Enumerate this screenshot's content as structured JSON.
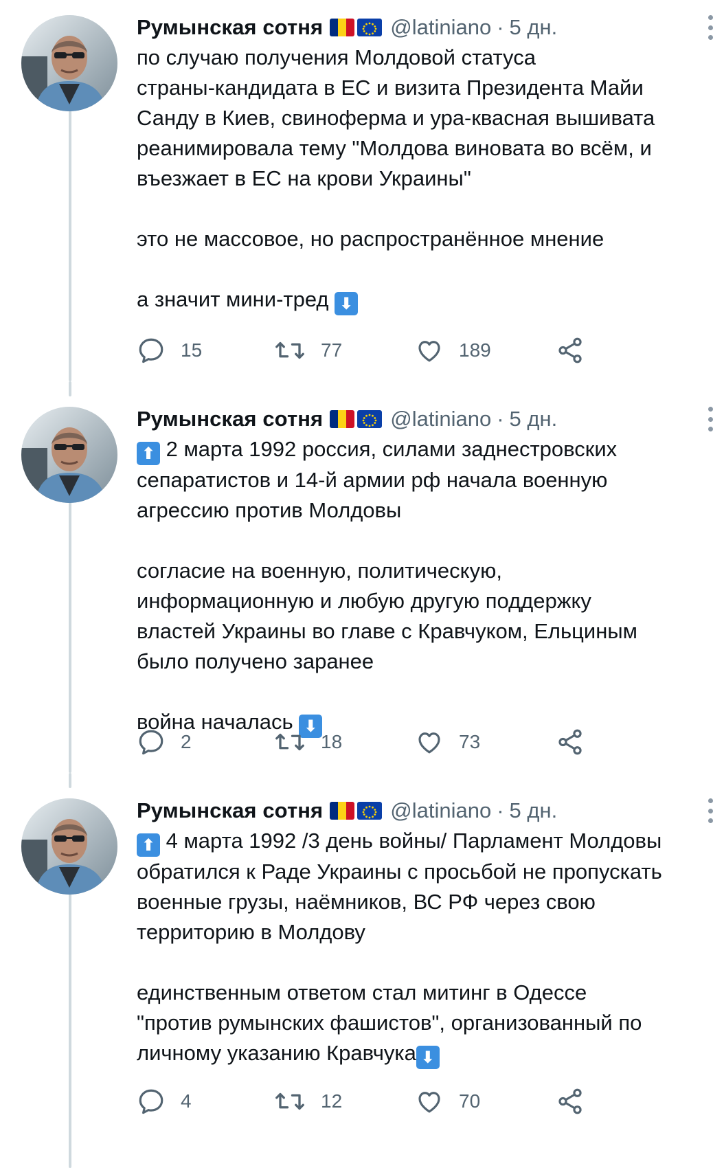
{
  "tweets": [
    {
      "author": "Румынская сотня",
      "handle": "@latiniano",
      "separator": "·",
      "time": "5 дн.",
      "lines": [
        "по случаю получения Молдовой статуса",
        "страны-кандидата в ЕС и визита Президента Майи",
        "Санду в Киев, свиноферма и ура-квасная вышивата",
        "реанимировала тему \"Молдова виновата во всём, и",
        "въезжает в ЕС на крови Украины\"",
        "",
        "это не массовое, но распространённое мнение",
        "",
        "а значит мини-тред"
      ],
      "replies": "15",
      "retweets": "77",
      "likes": "189"
    },
    {
      "author": "Румынская сотня",
      "handle": "@latiniano",
      "separator": "·",
      "time": "5 дн.",
      "lines": [
        "2 марта 1992 россия, силами заднестровских",
        "сепаратистов и 14-й армии рф начала военную",
        "агрессию против Молдовы",
        "",
        "согласие на военную, политическую,",
        "информационную и любую другую поддержку",
        "властей Украины во главе с Кравчуком, Ельциным",
        "было получено заранее",
        "",
        "война началась"
      ],
      "replies": "2",
      "retweets": "18",
      "likes": "73"
    },
    {
      "author": "Румынская сотня",
      "handle": "@latiniano",
      "separator": "·",
      "time": "5 дн.",
      "lines": [
        "4 марта 1992 /3 день войны/ Парламент Молдовы",
        "обратился к Раде Украины с просьбой не пропускать",
        "военные грузы, наёмников, ВС РФ через свою",
        "территорию в Молдову",
        "",
        "единственным ответом стал митинг в Одессе",
        "\"против румынских фашистов\", организованный по",
        "личному указанию Кравчука"
      ],
      "replies": "4",
      "retweets": "12",
      "likes": "70"
    }
  ],
  "icons": {
    "down_arrow_emoji": "⬇",
    "up_arrow_emoji": "⬆",
    "romania_flag": "romania-flag-icon",
    "eu_flag": "eu-flag-icon",
    "reply": "reply-icon",
    "retweet": "retweet-icon",
    "like": "heart-icon",
    "share": "share-icon",
    "more": "more-options-icon"
  },
  "colors": {
    "text": "#0f1419",
    "secondary": "#536471",
    "thread_line": "#cfd9de",
    "emoji_blue": "#3b8fe0"
  }
}
